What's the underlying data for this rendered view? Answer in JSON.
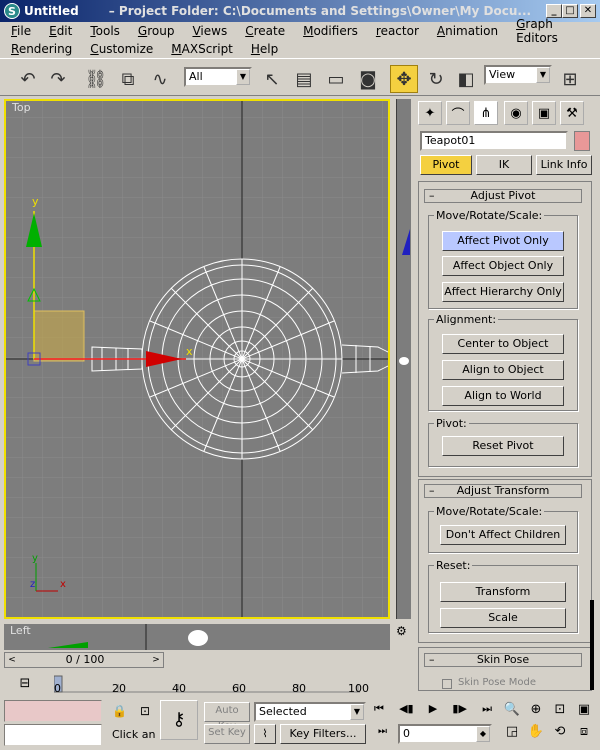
{
  "window": {
    "title": "Untitled",
    "subtitle": "– Project Folder: C:\\Documents and Settings\\Owner\\My Docu...",
    "min": "_",
    "max": "□",
    "close": "✕"
  },
  "menu": {
    "row1": [
      "File",
      "Edit",
      "Tools",
      "Group",
      "Views",
      "Create",
      "Modifiers",
      "reactor",
      "Animation",
      "Graph Editors"
    ],
    "row2": [
      "Rendering",
      "Customize",
      "MAXScript",
      "Help"
    ]
  },
  "toolbar": {
    "selection_filter": "All",
    "ref_coord": "View"
  },
  "viewport": {
    "label": "Top",
    "left_label": "Left",
    "axis_y": "y",
    "axis_x": "x",
    "axis_z": "z"
  },
  "command_panel": {
    "object_name": "Teapot01",
    "tabs": [
      "Pivot",
      "IK",
      "Link Info"
    ],
    "rollout_adjust_pivot": "Adjust Pivot",
    "group_move": "Move/Rotate/Scale:",
    "affect_pivot_only": "Affect Pivot Only",
    "affect_object_only": "Affect Object Only",
    "affect_hierarchy_only": "Affect Hierarchy Only",
    "group_alignment": "Alignment:",
    "center_to_object": "Center to Object",
    "align_to_object": "Align to Object",
    "align_to_world": "Align to World",
    "group_pivot": "Pivot:",
    "reset_pivot": "Reset Pivot",
    "rollout_adjust_transform": "Adjust Transform",
    "group_move2": "Move/Rotate/Scale:",
    "dont_affect_children": "Don't Affect Children",
    "group_reset": "Reset:",
    "transform": "Transform",
    "scale": "Scale",
    "rollout_skin_pose": "Skin Pose",
    "skin_pose_mode": "Skin Pose Mode"
  },
  "timeline": {
    "frame_counter": "0 / 100",
    "ticks": [
      "0",
      "20",
      "40",
      "60",
      "80",
      "100"
    ]
  },
  "status": {
    "prompt": "Click an",
    "auto_key": "Auto Key",
    "set_key": "Set Key",
    "key_mode": "Selected",
    "key_filters": "Key Filters...",
    "frame": "0"
  }
}
